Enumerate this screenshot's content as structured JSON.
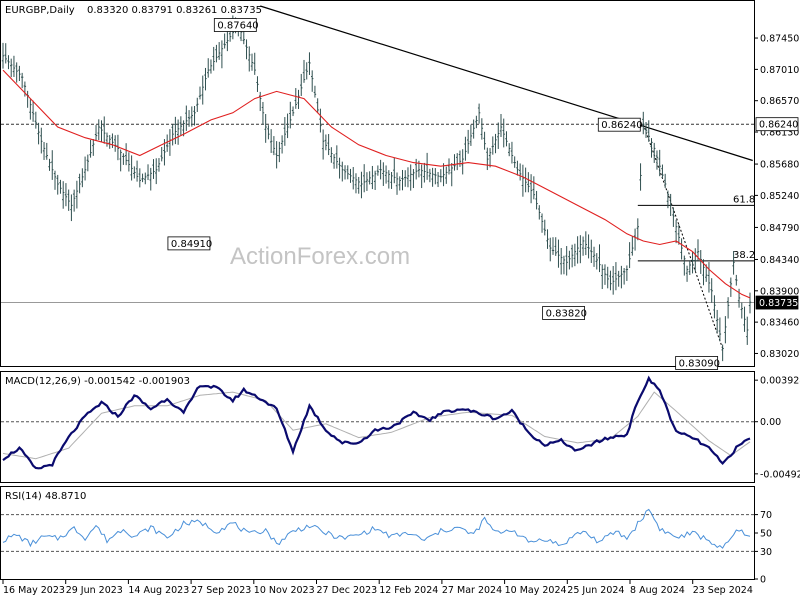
{
  "header": {
    "symbol": "EURGBP,Daily",
    "ohlc": "0.83320 0.83791 0.83261 0.83735"
  },
  "watermark": "ActionForex.com",
  "chart_data": [
    {
      "type": "line",
      "name": "price",
      "yticks": [
        "0.87450",
        "0.87010",
        "0.86570",
        "0.86130",
        "0.85680",
        "0.85240",
        "0.84790",
        "0.84340",
        "0.83900",
        "0.83460",
        "0.83020"
      ],
      "ylim": [
        0.829,
        0.879
      ],
      "xticks": [
        "16 May 2023",
        "29 Jun 2023",
        "14 Aug 2023",
        "27 Sep 2023",
        "10 Nov 2023",
        "27 Dec 2023",
        "12 Feb 2024",
        "27 Mar 2024",
        "10 May 2024",
        "25 Jun 2024",
        "8 Aug 2024",
        "23 Sep 2024"
      ],
      "price_path": [
        [
          0,
          0.872
        ],
        [
          7,
          0.869
        ],
        [
          14,
          0.86
        ],
        [
          20,
          0.854
        ],
        [
          25,
          0.851
        ],
        [
          30,
          0.856
        ],
        [
          35,
          0.862
        ],
        [
          42,
          0.859
        ],
        [
          50,
          0.8545
        ],
        [
          56,
          0.856
        ],
        [
          62,
          0.861
        ],
        [
          70,
          0.864
        ],
        [
          75,
          0.87
        ],
        [
          80,
          0.873
        ],
        [
          86,
          0.8764
        ],
        [
          92,
          0.87
        ],
        [
          96,
          0.862
        ],
        [
          100,
          0.858
        ],
        [
          106,
          0.864
        ],
        [
          112,
          0.871
        ],
        [
          117,
          0.86
        ],
        [
          124,
          0.856
        ],
        [
          131,
          0.854
        ],
        [
          138,
          0.856
        ],
        [
          145,
          0.8545
        ],
        [
          152,
          0.856
        ],
        [
          160,
          0.855
        ],
        [
          168,
          0.8575
        ],
        [
          174,
          0.864
        ],
        [
          177,
          0.8575
        ],
        [
          182,
          0.862
        ],
        [
          188,
          0.856
        ],
        [
          194,
          0.8525
        ],
        [
          200,
          0.845
        ],
        [
          206,
          0.843
        ],
        [
          212,
          0.846
        ],
        [
          216,
          0.844
        ],
        [
          222,
          0.84
        ],
        [
          228,
          0.842
        ],
        [
          232,
          0.848
        ],
        [
          234,
          0.8624
        ],
        [
          238,
          0.859
        ],
        [
          242,
          0.854
        ],
        [
          246,
          0.848
        ],
        [
          250,
          0.842
        ],
        [
          254,
          0.8445
        ],
        [
          259,
          0.839
        ],
        [
          263,
          0.8309
        ],
        [
          267,
          0.843
        ],
        [
          269,
          0.838
        ],
        [
          272,
          0.8335
        ],
        [
          273,
          0.8374
        ]
      ],
      "ma_path": [
        [
          0,
          0.87
        ],
        [
          10,
          0.866
        ],
        [
          20,
          0.862
        ],
        [
          30,
          0.8605
        ],
        [
          40,
          0.8595
        ],
        [
          50,
          0.858
        ],
        [
          58,
          0.8595
        ],
        [
          66,
          0.861
        ],
        [
          76,
          0.863
        ],
        [
          84,
          0.864
        ],
        [
          92,
          0.866
        ],
        [
          100,
          0.867
        ],
        [
          110,
          0.866
        ],
        [
          120,
          0.862
        ],
        [
          130,
          0.8595
        ],
        [
          140,
          0.858
        ],
        [
          150,
          0.857
        ],
        [
          160,
          0.8565
        ],
        [
          170,
          0.857
        ],
        [
          180,
          0.8565
        ],
        [
          190,
          0.855
        ],
        [
          200,
          0.853
        ],
        [
          210,
          0.851
        ],
        [
          220,
          0.849
        ],
        [
          228,
          0.847
        ],
        [
          234,
          0.846
        ],
        [
          240,
          0.8455
        ],
        [
          246,
          0.846
        ],
        [
          252,
          0.8445
        ],
        [
          258,
          0.842
        ],
        [
          264,
          0.84
        ],
        [
          270,
          0.8385
        ],
        [
          273,
          0.838
        ]
      ],
      "x_count": 274,
      "labels": [
        {
          "text": "0.87640",
          "x": 86,
          "y": 0.8764
        },
        {
          "text": "0.84910",
          "x": 42,
          "y": 0.8491
        },
        {
          "text": "0.86240",
          "x": 234,
          "y": 0.8624
        },
        {
          "text": "0.83820",
          "x": 210,
          "y": 0.8382
        },
        {
          "text": "0.83090",
          "x": 263,
          "y": 0.8309
        }
      ],
      "hline_label": "0.86240",
      "hline_value": 0.8624,
      "current_label": "0.83735",
      "current_value": 0.83735,
      "trendline": [
        [
          94,
          0.879
        ],
        [
          274,
          0.8573
        ]
      ],
      "fib": [
        {
          "label": "61.8",
          "value": 0.851,
          "from": 232
        },
        {
          "label": "38.2",
          "value": 0.8432,
          "from": 232
        }
      ]
    },
    {
      "type": "line",
      "name": "MACD",
      "header": "MACD(12,26,9) -0.001542 -0.001903",
      "yticks": [
        "0.003928",
        "0.00",
        "-0.004929"
      ],
      "ylim": [
        -0.0057,
        0.0047
      ],
      "macd_path": [
        [
          0,
          -0.0035
        ],
        [
          6,
          -0.0025
        ],
        [
          12,
          -0.0045
        ],
        [
          18,
          -0.004
        ],
        [
          24,
          -0.0015
        ],
        [
          30,
          0.0005
        ],
        [
          36,
          0.0018
        ],
        [
          42,
          0.0005
        ],
        [
          48,
          0.0025
        ],
        [
          54,
          0.0012
        ],
        [
          60,
          0.0022
        ],
        [
          66,
          0.0008
        ],
        [
          72,
          0.0035
        ],
        [
          78,
          0.0032
        ],
        [
          84,
          0.002
        ],
        [
          88,
          0.003
        ],
        [
          94,
          0.0022
        ],
        [
          100,
          0.0012
        ],
        [
          106,
          -0.0028
        ],
        [
          112,
          0.0015
        ],
        [
          118,
          -0.0008
        ],
        [
          124,
          -0.002
        ],
        [
          130,
          -0.002
        ],
        [
          136,
          -0.0008
        ],
        [
          142,
          -0.0005
        ],
        [
          150,
          0.0008
        ],
        [
          156,
          0.0002
        ],
        [
          162,
          0.001
        ],
        [
          168,
          0.0012
        ],
        [
          174,
          0.0008
        ],
        [
          180,
          0.0003
        ],
        [
          186,
          0.001
        ],
        [
          192,
          -0.001
        ],
        [
          198,
          -0.0022
        ],
        [
          204,
          -0.0018
        ],
        [
          210,
          -0.0028
        ],
        [
          216,
          -0.002
        ],
        [
          222,
          -0.0015
        ],
        [
          228,
          -0.0012
        ],
        [
          232,
          0.002
        ],
        [
          236,
          0.004
        ],
        [
          240,
          0.003
        ],
        [
          246,
          -0.001
        ],
        [
          252,
          -0.0015
        ],
        [
          258,
          -0.0025
        ],
        [
          263,
          -0.004
        ],
        [
          268,
          -0.0025
        ],
        [
          273,
          -0.0015
        ]
      ],
      "signal_path": [
        [
          0,
          -0.003
        ],
        [
          12,
          -0.0035
        ],
        [
          24,
          -0.0025
        ],
        [
          36,
          0.0008
        ],
        [
          48,
          0.0015
        ],
        [
          60,
          0.0015
        ],
        [
          72,
          0.0025
        ],
        [
          84,
          0.0028
        ],
        [
          96,
          0.002
        ],
        [
          106,
          -0.0008
        ],
        [
          118,
          -0.0002
        ],
        [
          130,
          -0.0015
        ],
        [
          142,
          -0.001
        ],
        [
          156,
          0.0004
        ],
        [
          170,
          0.0009
        ],
        [
          186,
          0.0006
        ],
        [
          198,
          -0.0014
        ],
        [
          210,
          -0.002
        ],
        [
          222,
          -0.0016
        ],
        [
          232,
          0.0005
        ],
        [
          238,
          0.0028
        ],
        [
          246,
          0.001
        ],
        [
          258,
          -0.0018
        ],
        [
          266,
          -0.0032
        ],
        [
          273,
          -0.0019
        ]
      ]
    },
    {
      "type": "line",
      "name": "RSI",
      "header": "RSI(14) 48.8710",
      "yticks": [
        "70",
        "50",
        "30",
        "0"
      ],
      "ylim": [
        0,
        100
      ],
      "rsi_path": [
        [
          0,
          42
        ],
        [
          5,
          48
        ],
        [
          10,
          38
        ],
        [
          15,
          46
        ],
        [
          20,
          44
        ],
        [
          26,
          55
        ],
        [
          30,
          45
        ],
        [
          34,
          58
        ],
        [
          38,
          42
        ],
        [
          44,
          55
        ],
        [
          48,
          46
        ],
        [
          54,
          56
        ],
        [
          60,
          45
        ],
        [
          66,
          60
        ],
        [
          72,
          62
        ],
        [
          78,
          52
        ],
        [
          84,
          61
        ],
        [
          90,
          48
        ],
        [
          96,
          54
        ],
        [
          100,
          38
        ],
        [
          106,
          52
        ],
        [
          112,
          58
        ],
        [
          118,
          50
        ],
        [
          124,
          44
        ],
        [
          130,
          48
        ],
        [
          136,
          55
        ],
        [
          142,
          46
        ],
        [
          148,
          50
        ],
        [
          154,
          42
        ],
        [
          160,
          52
        ],
        [
          166,
          56
        ],
        [
          172,
          48
        ],
        [
          176,
          65
        ],
        [
          180,
          50
        ],
        [
          186,
          54
        ],
        [
          192,
          40
        ],
        [
          198,
          44
        ],
        [
          204,
          36
        ],
        [
          208,
          46
        ],
        [
          212,
          52
        ],
        [
          218,
          40
        ],
        [
          224,
          52
        ],
        [
          228,
          44
        ],
        [
          232,
          60
        ],
        [
          236,
          76
        ],
        [
          240,
          55
        ],
        [
          246,
          45
        ],
        [
          252,
          50
        ],
        [
          258,
          42
        ],
        [
          263,
          32
        ],
        [
          268,
          52
        ],
        [
          273,
          48.87
        ]
      ]
    }
  ],
  "colors": {
    "price": "#2f4f4f",
    "ma": "#e02020",
    "macd": "#0a0a6e",
    "signal": "#b0b0b0",
    "rsi": "#4a90d9",
    "grid_line": "#555555"
  }
}
